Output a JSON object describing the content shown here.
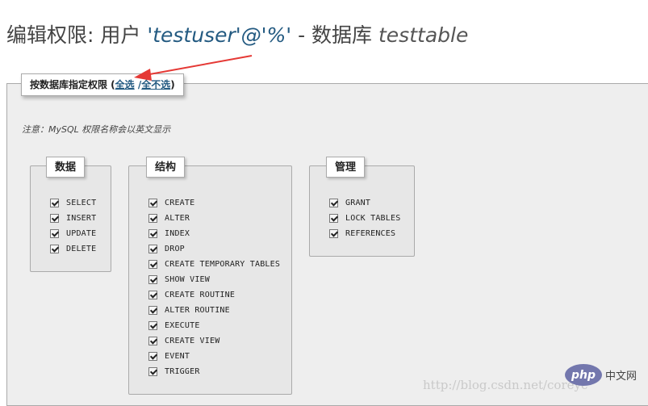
{
  "title": {
    "prefix": "编辑权限: 用户 ",
    "user": "'testuser'@'%'",
    "middle": " - 数据库 ",
    "database": "testtable"
  },
  "legend": {
    "label": "按数据库指定权限 (",
    "select_all": "全选",
    "separator": " /",
    "deselect_all": "全不选",
    "close": ")"
  },
  "note": "注意：MySQL 权限名称会以英文显示",
  "groups": {
    "data": {
      "title": "数据",
      "items": [
        "SELECT",
        "INSERT",
        "UPDATE",
        "DELETE"
      ]
    },
    "structure": {
      "title": "结构",
      "items": [
        "CREATE",
        "ALTER",
        "INDEX",
        "DROP",
        "CREATE TEMPORARY TABLES",
        "SHOW VIEW",
        "CREATE ROUTINE",
        "ALTER ROUTINE",
        "EXECUTE",
        "CREATE VIEW",
        "EVENT",
        "TRIGGER"
      ]
    },
    "admin": {
      "title": "管理",
      "items": [
        "GRANT",
        "LOCK TABLES",
        "REFERENCES"
      ]
    }
  },
  "checked": true,
  "watermark": {
    "url": "http://blog.csdn.net/coreyc",
    "logo_text": "php",
    "logo_cn": "中文网"
  },
  "colors": {
    "accent": "#235a81",
    "arrow": "#e53935",
    "panel": "#eeeeee"
  }
}
